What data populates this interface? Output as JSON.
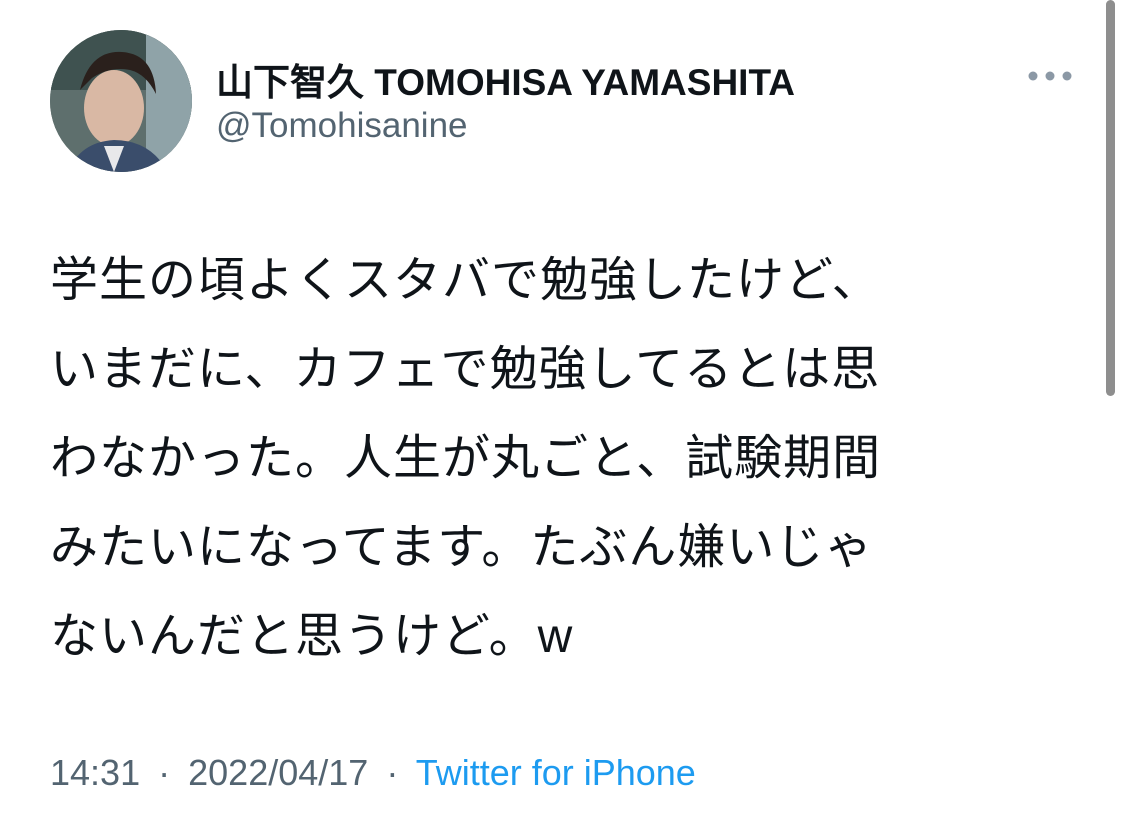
{
  "tweet": {
    "author": {
      "display_name": "山下智久 TOMOHISA YAMASHITA",
      "handle": "@Tomohisanine",
      "avatar_icon": "profile-photo"
    },
    "more_icon": "more-horizontal-icon",
    "text": "学生の頃よくスタバで勉強したけど、\nいまだに、カフェで勉強してるとは思\nわなかった。人生が丸ごと、試験期間\nみたいになってます。たぶん嫌いじゃ\nないんだと思うけど。w",
    "time": "14:31",
    "separator": "·",
    "date": "2022/04/17",
    "source": "Twitter for iPhone"
  },
  "colors": {
    "text": "#0f1419",
    "secondary": "#536471",
    "link": "#1d9bf0"
  }
}
